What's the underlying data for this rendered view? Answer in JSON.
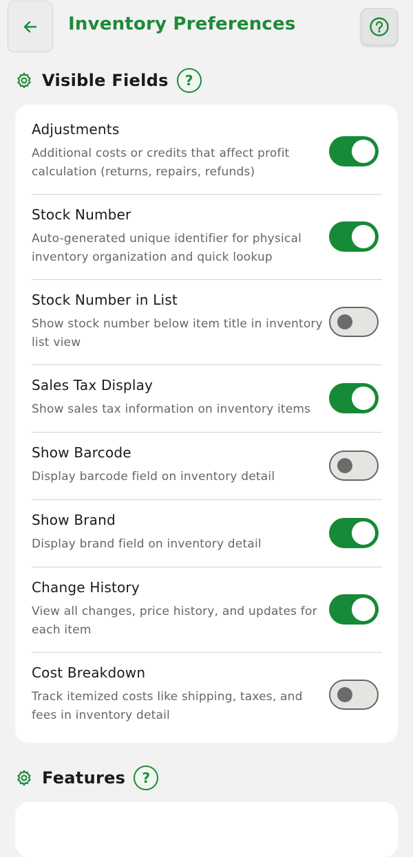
{
  "header": {
    "title": "Inventory Preferences"
  },
  "visible_fields": {
    "title": "Visible Fields",
    "help_glyph": "?",
    "items": [
      {
        "title": "Adjustments",
        "description": "Additional costs or credits that affect profit calculation (returns, repairs, refunds)",
        "enabled": true
      },
      {
        "title": "Stock Number",
        "description": "Auto-generated unique identifier for physical inventory organization and quick lookup",
        "enabled": true
      },
      {
        "title": "Stock Number in List",
        "description": "Show stock number below item title in inventory list view",
        "enabled": false
      },
      {
        "title": "Sales Tax Display",
        "description": "Show sales tax information on inventory items",
        "enabled": true
      },
      {
        "title": "Show Barcode",
        "description": "Display barcode field on inventory detail",
        "enabled": false
      },
      {
        "title": "Show Brand",
        "description": "Display brand field on inventory detail",
        "enabled": true
      },
      {
        "title": "Change History",
        "description": "View all changes, price history, and updates for each item",
        "enabled": true
      },
      {
        "title": "Cost Breakdown",
        "description": "Track itemized costs like shipping, taxes, and fees in inventory detail",
        "enabled": false
      }
    ]
  },
  "features": {
    "title": "Features",
    "help_glyph": "?"
  },
  "colors": {
    "accent": "#1e8a3a",
    "toggle_on": "#168a36",
    "background": "#f2f2f2"
  },
  "icons": {
    "back": "arrow-left-icon",
    "help": "help-circle-icon",
    "section": "gear-icon"
  }
}
